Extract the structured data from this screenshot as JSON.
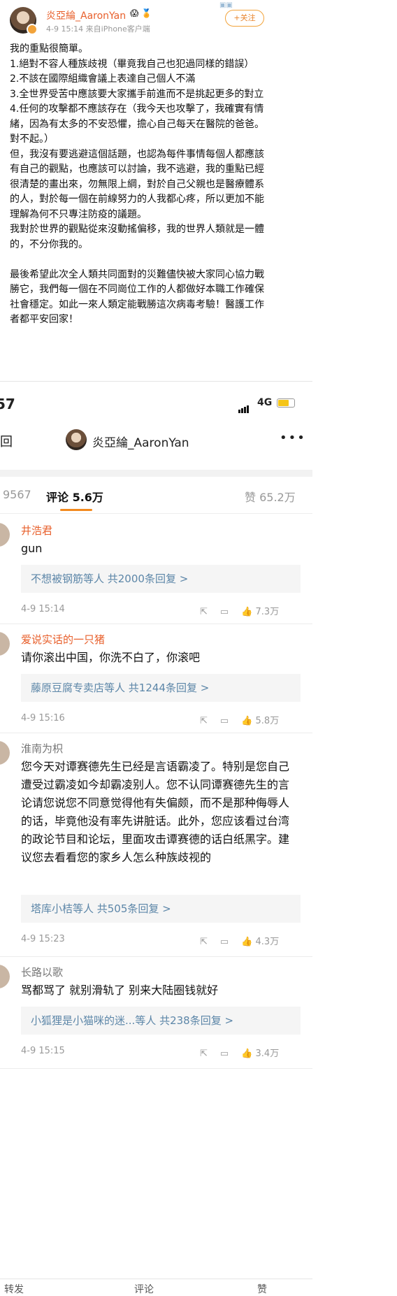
{
  "post": {
    "username": "炎亞綸_AaronYan",
    "meta": "4-9 15:14  来自iPhone客户端",
    "follow_label": "+关注",
    "text": "我的重點很簡單。\n1.絕對不容人種族歧視（畢竟我自己也犯過同樣的錯誤）\n2.不該在國際組織會議上表達自己個人不滿\n3.全世界受苦中應該要大家攜手前進而不是挑起更多的對立\n4.任何的攻擊都不應該存在（我今天也攻擊了，我確實有情緒，因為有太多的不安恐懼，擔心自己每天在醫院的爸爸。對不起。）\n但，我沒有要逃避這個話題，也認為每件事情每個人都應該有自己的觀點，也應該可以討論，我不逃避，我的重點已經很清楚的畫出來，勿無限上綱，對於自己父親也是醫療體系的人，對於每一個在前線努力的人我都心疼，所以更加不能理解為何不只專注防疫的議題。\n我對於世界的觀點從來沒動搖偏移，我的世界人類就是一體的，不分你我的。\n\n最後希望此次全人類共同面對的災難儘快被大家同心協力戰勝它，我們每一個在不同崗位工作的人都做好本職工作確保社會穩定。如此一來人類定能戰勝這次病毒考驗！醫護工作者都平安回家！"
  },
  "phone": {
    "time": ":57",
    "network": "4G",
    "nav_title": "炎亞綸_AaronYan",
    "back_label": "回",
    "more_label": "•••"
  },
  "tabs": {
    "repost_count": "9567",
    "comments_label": "评论 5.6万",
    "likes_label": "赞 65.2万"
  },
  "comments": [
    {
      "name": "井浩君",
      "text": "gun",
      "reply": "不想被钢筋等人  共2000条回复 >",
      "date": "4-9 15:14",
      "likes": "7.3万"
    },
    {
      "name": "爱说实话的一只猪",
      "text": "请你滚出中国，你洗不白了，你滚吧",
      "reply": "藤原豆腐专卖店等人  共1244条回复 >",
      "date": "4-9 15:16",
      "likes": "5.8万"
    },
    {
      "name": "淮南为枳",
      "text": "您今天对谭赛德先生已经是言语霸凌了。特别是您自己遭受过霸凌如今却霸凌别人。您不认同谭赛德先生的言论请您说您不同意觉得他有失偏颇，而不是那种侮辱人的话，毕竟他没有率先讲脏话。此外，您应该看过台湾的政论节目和论坛，里面攻击谭赛德的话白纸黑字。建议您去看看您的家乡人怎么种族歧视的",
      "reply": "塔库小桔等人  共505条回复 >",
      "date": "4-9 15:23",
      "likes": "4.3万"
    },
    {
      "name": "长路以歌",
      "text": "骂都骂了 就别滑轨了 别来大陆圈钱就好",
      "reply": "小狐狸是小猫咪的迷...等人  共238条回复 >",
      "date": "4-9 15:15",
      "likes": "3.4万"
    }
  ],
  "bottom": {
    "repost_label": "转发",
    "comment_label": "评论",
    "like_label": "赞"
  }
}
